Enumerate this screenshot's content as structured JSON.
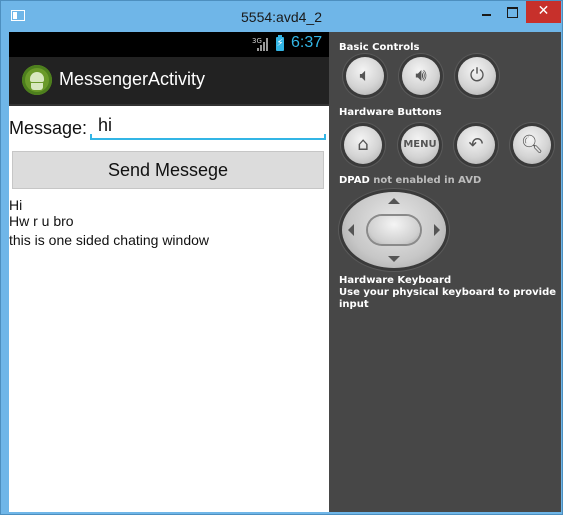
{
  "window": {
    "title": "5554:avd4_2",
    "close_glyph": "✕"
  },
  "statusbar": {
    "network": "3G",
    "time": "6:37",
    "battery_color": "#33b5e5"
  },
  "actionbar": {
    "title": "MessengerActivity"
  },
  "form": {
    "message_label": "Message:",
    "message_value": "hi",
    "send_label": "Send Messege"
  },
  "chat": {
    "lines": [
      "Hi",
      "Hw r u bro",
      "this is one sided chating window"
    ]
  },
  "panel": {
    "basic_controls": "Basic Controls",
    "hardware_buttons": "Hardware Buttons",
    "menu_label": "MENU",
    "dpad_title": "DPAD",
    "dpad_note": "not enabled in AVD",
    "hw_keyboard_title": "Hardware Keyboard",
    "hw_keyboard_note": "Use your physical keyboard to provide input"
  },
  "icons": {
    "volume_down": "volume-down-icon",
    "volume_up": "volume-up-icon",
    "power": "power-icon",
    "home": "home-icon",
    "back": "back-icon",
    "search": "search-icon"
  }
}
